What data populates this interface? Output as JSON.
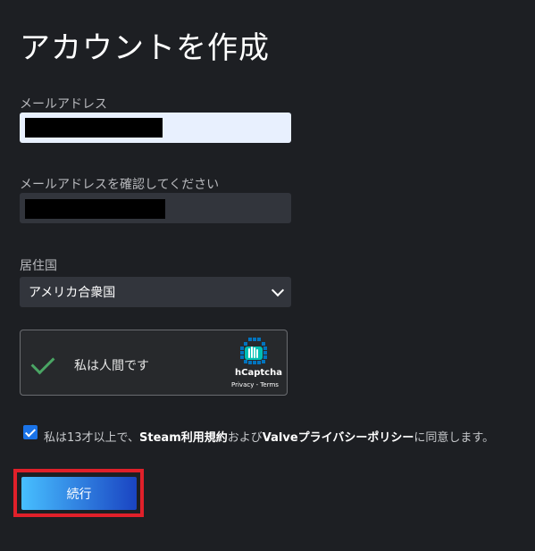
{
  "page": {
    "title": "アカウントを作成"
  },
  "email": {
    "label": "メールアドレス",
    "value": ""
  },
  "email_confirm": {
    "label": "メールアドレスを確認してください",
    "value": ""
  },
  "country": {
    "label": "居住国",
    "selected": "アメリカ合衆国"
  },
  "captcha": {
    "text": "私は人間です",
    "brand": "hCaptcha",
    "links": "Privacy - Terms",
    "checked": true
  },
  "agreement": {
    "checked": true,
    "prefix": "私は13才以上で、",
    "link1": "Steam利用規約",
    "mid": "および",
    "link2": "Valveプライバシーポリシー",
    "suffix": "に同意します。"
  },
  "continue_button": {
    "label": "続行"
  },
  "colors": {
    "accent_gradient_start": "#47bfff",
    "accent_gradient_end": "#1a44c2",
    "highlight_border": "#e0202a",
    "captcha_check": "#4aa564"
  }
}
